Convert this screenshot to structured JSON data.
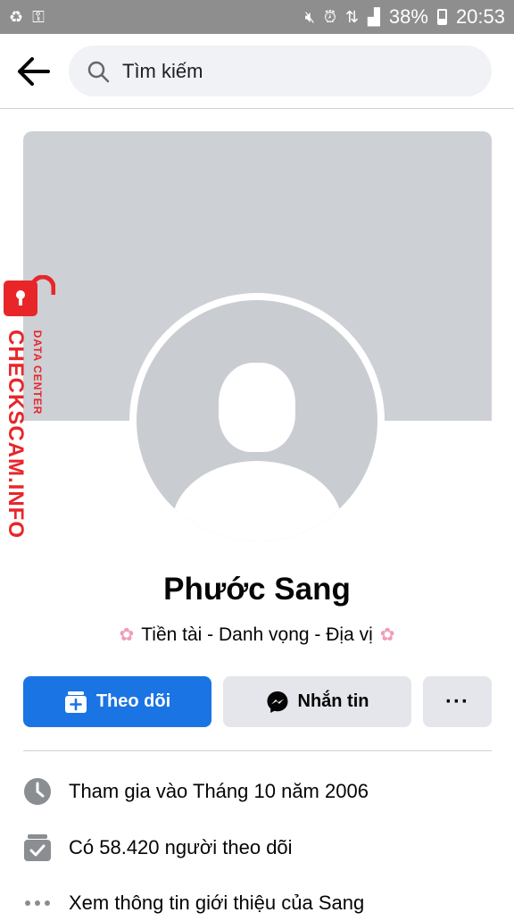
{
  "status_bar": {
    "battery": "38%",
    "time": "20:53"
  },
  "search": {
    "placeholder": "Tìm kiếm"
  },
  "profile": {
    "name": "Phước Sang",
    "bio": "Tiền tài - Danh vọng - Địa vị"
  },
  "actions": {
    "follow_label": "Theo dõi",
    "message_label": "Nhắn tin",
    "more_label": "···"
  },
  "info": {
    "joined": "Tham gia vào Tháng 10 năm 2006",
    "followers": "Có 58.420 người theo dõi",
    "about": "Xem thông tin giới thiệu của Sang"
  },
  "watermark": {
    "main": "CHECKSCAM.INFO",
    "sub": "DATA CENTER"
  },
  "colors": {
    "accent": "#1b74e4",
    "cover": "#cdd0d5",
    "button_secondary": "#e4e6eb",
    "watermark": "#e8262a"
  }
}
